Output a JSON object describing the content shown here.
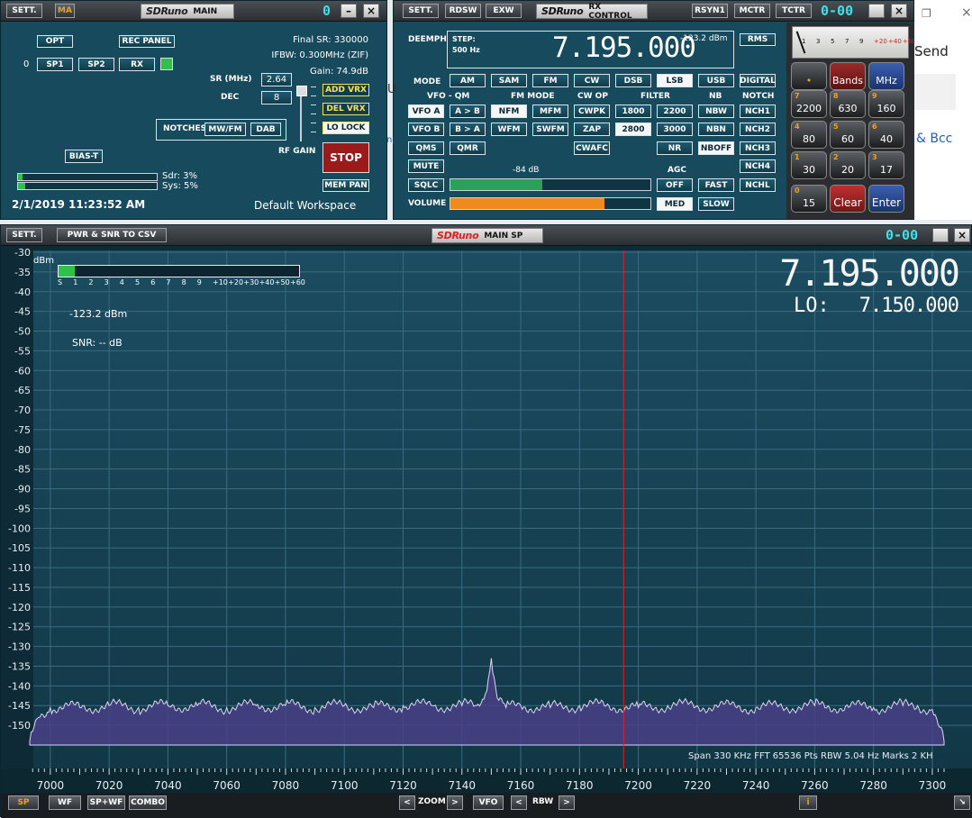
{
  "main": {
    "sett": "SETT.",
    "ma": "MA",
    "brand": "SDRuno",
    "title": "MAIN",
    "counter": "0",
    "opt": "OPT",
    "rec_panel": "REC PANEL",
    "final_sr": "Final SR: 330000",
    "ifbw": "IFBW: 0.300MHz (ZIF)",
    "gain": "Gain: 74.9dB",
    "rx_num": "0",
    "sp1": "SP1",
    "sp2": "SP2",
    "rx": "RX",
    "sr_label": "SR (MHz)",
    "sr_value": "2.64",
    "dec_label": "DEC",
    "dec_value": "8",
    "add_vrx": "ADD VRX",
    "del_vrx": "DEL VRX",
    "lo_lock": "LO LOCK",
    "notches": "NOTCHES",
    "mwfm": "MW/FM",
    "dab": "DAB",
    "rf_gain": "RF GAIN",
    "stop": "STOP",
    "bias_t": "BIAS-T",
    "sdr": "Sdr: 3%",
    "sys": "Sys: 5%",
    "sdr_level": 0.03,
    "sys_level": 0.05,
    "datetime": "2/1/2019 11:23:52 AM",
    "workspace": "Default Workspace",
    "mem_pan": "MEM PAN"
  },
  "rx": {
    "sett": "SETT.",
    "rdsw": "RDSW",
    "exw": "EXW",
    "brand": "SDRuno",
    "title": "RX CONTROL",
    "rsyn1": "RSYN1",
    "mctr": "MCTR",
    "tctr": "TCTR",
    "counter": "0-00",
    "deemph": "DEEMPH",
    "step_label": "STEP:",
    "step_value": "500 Hz",
    "frequency": "7.195.000",
    "dbm": "-123.2 dBm",
    "rms": "RMS",
    "mode_label": "MODE",
    "modes": [
      "AM",
      "SAM",
      "FM",
      "CW",
      "DSB",
      "LSB",
      "USB",
      "DIGITAL"
    ],
    "vfo_qm": "VFO - QM",
    "fm_mode": "FM MODE",
    "cw_op": "CW OP",
    "filter": "FILTER",
    "nb": "NB",
    "notch": "NOTCH",
    "vfo_a": "VFO A",
    "a_b": "A > B",
    "nfm": "NFM",
    "mfm": "MFM",
    "cwpk": "CWPK",
    "f1800": "1800",
    "f2200": "2200",
    "nbw": "NBW",
    "nch1": "NCH1",
    "vfo_b": "VFO B",
    "b_a": "B > A",
    "wfm": "WFM",
    "swfm": "SWFM",
    "zap": "ZAP",
    "f2800": "2800",
    "f3000": "3000",
    "nbn": "NBN",
    "nch2": "NCH2",
    "qms": "QMS",
    "qmr": "QMR",
    "cwafc": "CWAFC",
    "nr": "NR",
    "nboff": "NBOFF",
    "nch3": "NCH3",
    "mute": "MUTE",
    "agc": "AGC",
    "nch4": "NCH4",
    "sqlc": "SQLC",
    "sql_db": "-84 dB",
    "sql_level": 0.46,
    "off": "OFF",
    "fast": "FAST",
    "nchl": "NCHL",
    "volume": "VOLUME",
    "volume_level": 0.77,
    "med": "MED",
    "slow": "SLOW",
    "meter_scale": [
      "1",
      "3",
      "5",
      "7",
      "9",
      "+20",
      "+40",
      "+60"
    ],
    "bands": "Bands",
    "mhz": "MHz",
    "keys": [
      {
        "n": "7",
        "v": "2200"
      },
      {
        "n": "8",
        "v": "630"
      },
      {
        "n": "9",
        "v": "160"
      },
      {
        "n": "4",
        "v": "80"
      },
      {
        "n": "5",
        "v": "60"
      },
      {
        "n": "6",
        "v": "40"
      },
      {
        "n": "1",
        "v": "30"
      },
      {
        "n": "2",
        "v": "20"
      },
      {
        "n": "3",
        "v": "17"
      },
      {
        "n": "0",
        "v": "15"
      }
    ],
    "clear": "Clear",
    "enter": "Enter"
  },
  "bg": {
    "send": "Send",
    "bcc": "& Bcc",
    "stray": "U",
    "stray2": "n;"
  },
  "sp": {
    "sett": "SETT.",
    "pwr_snr": "PWR & SNR TO CSV",
    "brand": "SDRuno",
    "title": "MAIN SP",
    "counter": "0-00",
    "frequency": "7.195.000",
    "lo_label": "LO:",
    "lo_value": "7.150.000",
    "dbm_label": "dBm",
    "smeter_scale": [
      "S",
      "1",
      "2",
      "3",
      "4",
      "5",
      "6",
      "7",
      "8",
      "9",
      "+10",
      "+20",
      "+30",
      "+40",
      "+50",
      "+60"
    ],
    "level": "-123.2 dBm",
    "snr": "SNR: -- dB",
    "y_labels": [
      "-30",
      "-35",
      "-40",
      "-45",
      "-50",
      "-55",
      "-60",
      "-65",
      "-70",
      "-75",
      "-80",
      "-85",
      "-90",
      "-95",
      "-100",
      "-105",
      "-110",
      "-115",
      "-120",
      "-125",
      "-130",
      "-135",
      "-140",
      "-145",
      "-150"
    ],
    "x_labels": [
      "7000",
      "7020",
      "7040",
      "7060",
      "7080",
      "7100",
      "7120",
      "7140",
      "7160",
      "7180",
      "7200",
      "7220",
      "7240",
      "7260",
      "7280",
      "7300"
    ],
    "info": "Span 330 KHz   FFT 65536 Pts   RBW 5.04 Hz   Marks 2 KH",
    "sp_btn": "SP",
    "wf": "WF",
    "spwf": "SP+WF",
    "combo": "COMBO",
    "zoom": "ZOOM",
    "vfo": "VFO",
    "rbw": "RBW",
    "info_btn": "i"
  },
  "chart_data": {
    "type": "line",
    "xlabel": "",
    "ylabel": "dBm",
    "xlim": [
      6993,
      7304
    ],
    "ylim": [
      -155,
      -30
    ],
    "vfo_khz": 7195,
    "x": [
      6993,
      6996,
      7000,
      7010,
      7020,
      7030,
      7040,
      7050,
      7060,
      7070,
      7080,
      7090,
      7100,
      7110,
      7120,
      7130,
      7140,
      7145,
      7148,
      7150,
      7152,
      7155,
      7160,
      7170,
      7180,
      7190,
      7200,
      7210,
      7220,
      7240,
      7260,
      7280,
      7290,
      7295,
      7300,
      7304
    ],
    "y": [
      -154,
      -148,
      -145.5,
      -145.5,
      -145,
      -145.5,
      -145,
      -145,
      -145.5,
      -145,
      -145,
      -145.5,
      -145,
      -145.5,
      -145,
      -145,
      -145,
      -145,
      -142,
      -133,
      -143,
      -145.5,
      -145,
      -145.5,
      -145,
      -145,
      -145.5,
      -145,
      -145,
      -145.5,
      -145,
      -145.5,
      -145,
      -145,
      -146,
      -154
    ]
  }
}
